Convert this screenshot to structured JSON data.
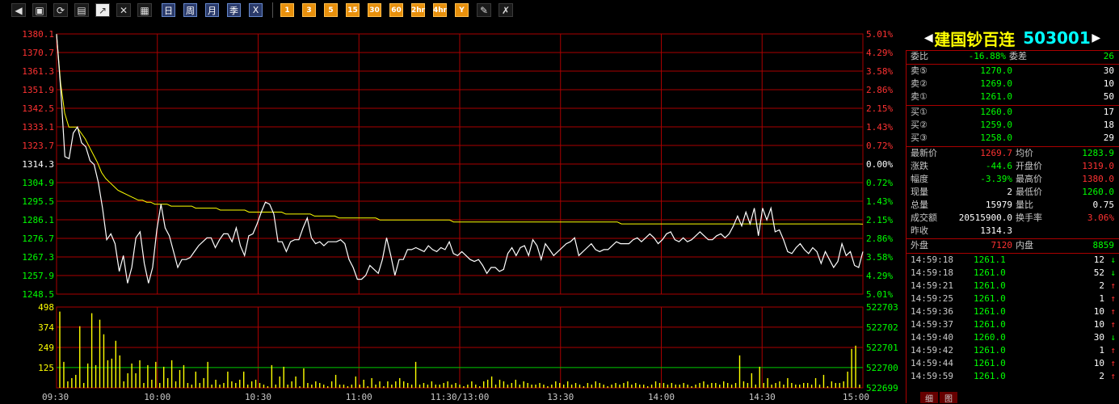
{
  "toolbar": {
    "icons": [
      "back-icon",
      "box-icon",
      "refresh-icon",
      "clipboard-icon",
      "chart-line-icon",
      "chart-cross-icon",
      "table-icon"
    ],
    "periods": [
      "日",
      "周",
      "月",
      "季",
      "X"
    ],
    "numbers": [
      "1",
      "3",
      "5",
      "15",
      "30",
      "60",
      "2hr",
      "4hr",
      "Y"
    ],
    "tools": [
      "edit-icon",
      "tools-icon"
    ]
  },
  "stock": {
    "name": "建国钞百连",
    "code": "503001"
  },
  "quote": {
    "wei_bi_label": "委比",
    "wei_bi": "-16.88%",
    "wei_cha_label": "委差",
    "wei_cha": "26",
    "sell": [
      {
        "label": "卖⑤",
        "price": "1270.0",
        "vol": "30"
      },
      {
        "label": "卖②",
        "price": "1269.0",
        "vol": "10"
      },
      {
        "label": "卖①",
        "price": "1261.0",
        "vol": "50"
      }
    ],
    "buy": [
      {
        "label": "买①",
        "price": "1260.0",
        "vol": "17"
      },
      {
        "label": "买②",
        "price": "1259.0",
        "vol": "18"
      },
      {
        "label": "买③",
        "price": "1258.0",
        "vol": "29"
      }
    ],
    "stats": [
      {
        "l1": "最新价",
        "v1": "1269.7",
        "l2": "均价",
        "v2": "1283.9"
      },
      {
        "l1": "涨跌",
        "v1": "-44.6",
        "l2": "开盘价",
        "v2": "1319.0"
      },
      {
        "l1": "幅度",
        "v1": "-3.39%",
        "l2": "最高价",
        "v2": "1380.0"
      },
      {
        "l1": "现量",
        "v1": "2",
        "l2": "最低价",
        "v2": "1260.0"
      },
      {
        "l1": "总量",
        "v1": "15979",
        "l2": "量比",
        "v2": "0.75"
      },
      {
        "l1": "成交额",
        "v1": "20515900.0",
        "l2": "换手率",
        "v2": "3.06%"
      }
    ],
    "prev_close_label": "昨收",
    "prev_close": "1314.3",
    "outer_label": "外盘",
    "outer": "7120",
    "inner_label": "内盘",
    "inner": "8859"
  },
  "ticks": [
    {
      "t": "14:59:18",
      "p": "1261.1",
      "v": "12",
      "d": "down"
    },
    {
      "t": "14:59:18",
      "p": "1261.0",
      "v": "52",
      "d": "down"
    },
    {
      "t": "14:59:21",
      "p": "1261.0",
      "v": "2",
      "d": "up"
    },
    {
      "t": "14:59:25",
      "p": "1261.0",
      "v": "1",
      "d": "up"
    },
    {
      "t": "14:59:36",
      "p": "1261.0",
      "v": "10",
      "d": "up"
    },
    {
      "t": "14:59:37",
      "p": "1261.0",
      "v": "10",
      "d": "up"
    },
    {
      "t": "14:59:40",
      "p": "1260.0",
      "v": "30",
      "d": "down"
    },
    {
      "t": "14:59:42",
      "p": "1261.0",
      "v": "1",
      "d": "up"
    },
    {
      "t": "14:59:44",
      "p": "1261.0",
      "v": "10",
      "d": "up"
    },
    {
      "t": "14:59:59",
      "p": "1261.0",
      "v": "2",
      "d": "up"
    }
  ],
  "tabs": [
    "细",
    "图"
  ],
  "chart_data": {
    "type": "line",
    "price_ticks": [
      "1380.1",
      "1370.7",
      "1361.3",
      "1351.9",
      "1342.5",
      "1333.1",
      "1323.7",
      "1314.3",
      "1304.9",
      "1295.5",
      "1286.1",
      "1276.7",
      "1267.3",
      "1257.9",
      "1248.5"
    ],
    "pct_ticks": [
      "5.01%",
      "4.29%",
      "3.58%",
      "2.86%",
      "2.15%",
      "1.43%",
      "0.72%",
      "0.00%",
      "0.72%",
      "1.43%",
      "2.15%",
      "2.86%",
      "3.58%",
      "4.29%",
      "5.01%"
    ],
    "vol_ticks": [
      "498",
      "374",
      "249",
      "125"
    ],
    "vol_right_ticks": [
      "522703",
      "522702",
      "522701",
      "522700",
      "522699"
    ],
    "time_labels": [
      "09:30",
      "10:00",
      "10:30",
      "11:00",
      "11:30/13:00",
      "13:30",
      "14:00",
      "14:30",
      "15:00"
    ],
    "ylim": [
      1248.5,
      1380.1
    ],
    "vol_max": 498,
    "colors": {
      "price": "#ffffff",
      "avg": "#ffff00",
      "vol": "#ffff00",
      "grid": "#aa0000",
      "up": "#ff3232",
      "down": "#00ff00"
    },
    "series": [
      {
        "values": [
          1380,
          1352,
          1318,
          1317,
          1330,
          1333,
          1325,
          1323,
          1316,
          1314,
          1305,
          1292,
          1276,
          1279,
          1274,
          1260,
          1268,
          1254,
          1262,
          1277,
          1280,
          1264,
          1254,
          1262,
          1281,
          1294,
          1282,
          1278,
          1270,
          1262,
          1266,
          1266,
          1267,
          1270,
          1273,
          1275,
          1277,
          1277,
          1272,
          1276,
          1279,
          1279,
          1275,
          1282,
          1273,
          1268,
          1278,
          1279,
          1284,
          1290,
          1295,
          1294,
          1289,
          1275,
          1275,
          1270,
          1275,
          1276,
          1276,
          1282,
          1287,
          1277,
          1274,
          1275,
          1273,
          1275,
          1275,
          1275,
          1276,
          1274,
          1266,
          1262,
          1256,
          1256,
          1258,
          1263,
          1261,
          1259,
          1266,
          1277,
          1268,
          1258,
          1266,
          1266,
          1271,
          1271,
          1272,
          1271,
          1270,
          1273,
          1271,
          1270,
          1272,
          1271,
          1275,
          1269,
          1268,
          1270,
          1268,
          1266,
          1265,
          1266,
          1263,
          1259,
          1262,
          1262,
          1260,
          1261,
          1269,
          1272,
          1268,
          1272,
          1273,
          1268,
          1276,
          1273,
          1266,
          1274,
          1271,
          1268,
          1270,
          1272,
          1274,
          1275,
          1277,
          1268,
          1270,
          1272,
          1274,
          1271,
          1270,
          1271,
          1271,
          1273,
          1275,
          1274,
          1274,
          1274,
          1276,
          1277,
          1275,
          1277,
          1279,
          1277,
          1274,
          1276,
          1279,
          1280,
          1276,
          1275,
          1277,
          1275,
          1276,
          1278,
          1280,
          1278,
          1276,
          1276,
          1278,
          1279,
          1277,
          1279,
          1283,
          1288,
          1283,
          1290,
          1284,
          1292,
          1278,
          1292,
          1286,
          1292,
          1280,
          1281,
          1276,
          1270,
          1269,
          1272,
          1274,
          1271,
          1269,
          1272,
          1270,
          1264,
          1270,
          1266,
          1262,
          1265,
          1274,
          1268,
          1270,
          1263,
          1262,
          1270
        ]
      },
      {
        "values": [
          1380,
          1355,
          1340,
          1333,
          1333,
          1333,
          1330,
          1327,
          1323,
          1319,
          1315,
          1310,
          1307,
          1305,
          1303,
          1301,
          1300,
          1299,
          1298,
          1297,
          1296,
          1296,
          1295,
          1295,
          1294,
          1294,
          1294,
          1294,
          1293,
          1293,
          1293,
          1293,
          1293,
          1293,
          1292,
          1292,
          1292,
          1292,
          1292,
          1292,
          1291,
          1291,
          1291,
          1291,
          1291,
          1291,
          1291,
          1290,
          1290,
          1290,
          1290,
          1290,
          1290,
          1290,
          1290,
          1290,
          1289,
          1289,
          1289,
          1289,
          1289,
          1289,
          1289,
          1288,
          1288,
          1288,
          1288,
          1288,
          1288,
          1287,
          1287,
          1287,
          1287,
          1287,
          1287,
          1287,
          1287,
          1287,
          1287,
          1286,
          1286,
          1286,
          1286,
          1286,
          1286,
          1286,
          1286,
          1286,
          1286,
          1286,
          1286,
          1286,
          1286,
          1286,
          1286,
          1286,
          1286,
          1285,
          1285,
          1285,
          1285,
          1285,
          1285,
          1285,
          1285,
          1285,
          1285,
          1285,
          1285,
          1285,
          1285,
          1285,
          1285,
          1285,
          1285,
          1285,
          1285,
          1285,
          1285,
          1285,
          1285,
          1285,
          1285,
          1285,
          1285,
          1285,
          1285,
          1285,
          1285,
          1285,
          1285,
          1285,
          1285,
          1285,
          1285,
          1285,
          1285,
          1285,
          1284,
          1284,
          1284,
          1284,
          1284,
          1284,
          1284,
          1284,
          1284,
          1284,
          1284,
          1284,
          1284,
          1284,
          1284,
          1284,
          1284,
          1284,
          1284,
          1284,
          1284,
          1284,
          1284,
          1284,
          1284,
          1284,
          1284,
          1284,
          1284,
          1284,
          1284,
          1284,
          1284,
          1284,
          1284,
          1284,
          1284,
          1284,
          1284,
          1284,
          1284,
          1284,
          1284,
          1284,
          1284,
          1284,
          1284,
          1284,
          1284,
          1284,
          1284,
          1284,
          1284,
          1284,
          1284,
          1284,
          1284,
          1284,
          1284,
          1283.9
        ]
      }
    ],
    "volume": [
      470,
      160,
      40,
      60,
      80,
      380,
      30,
      150,
      460,
      140,
      420,
      330,
      170,
      180,
      290,
      200,
      40,
      90,
      150,
      90,
      170,
      30,
      140,
      50,
      160,
      30,
      130,
      60,
      170,
      40,
      110,
      140,
      30,
      20,
      100,
      30,
      60,
      160,
      20,
      50,
      20,
      30,
      100,
      40,
      30,
      50,
      100,
      20,
      40,
      50,
      30,
      20,
      10,
      140,
      20,
      70,
      130,
      20,
      40,
      70,
      10,
      120,
      30,
      20,
      40,
      30,
      20,
      10,
      40,
      80,
      20,
      20,
      10,
      20,
      70,
      20,
      50,
      10,
      60,
      20,
      40,
      10,
      40,
      20,
      40,
      60,
      40,
      30,
      20,
      160,
      20,
      30,
      20,
      40,
      20,
      20,
      30,
      40,
      20,
      30,
      20,
      10,
      20,
      40,
      20,
      10,
      40,
      50,
      70,
      20,
      50,
      40,
      20,
      30,
      50,
      20,
      40,
      30,
      20,
      20,
      30,
      20,
      10,
      20,
      40,
      30,
      20,
      40,
      20,
      30,
      20,
      10,
      30,
      20,
      40,
      30,
      20,
      10,
      20,
      30,
      20,
      30,
      40,
      20,
      30,
      20,
      20,
      10,
      20,
      40,
      30,
      30,
      20,
      30,
      20,
      20,
      30,
      20,
      10,
      20,
      30,
      40,
      20,
      30,
      30,
      20,
      40,
      30,
      20,
      30,
      200,
      40,
      30,
      90,
      20,
      130,
      30,
      60,
      20,
      30,
      40,
      20,
      60,
      30,
      20,
      20,
      30,
      30,
      20,
      60,
      20,
      80,
      10,
      40,
      30,
      30,
      40,
      100,
      240,
      260,
      20
    ]
  }
}
